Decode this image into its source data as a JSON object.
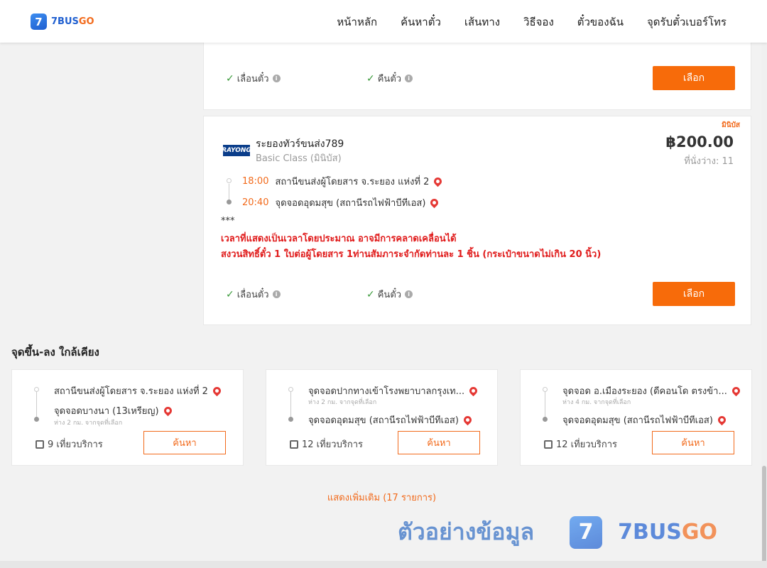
{
  "header": {
    "logo_mark": "7",
    "logo_a": "7BUS",
    "logo_b": "GO",
    "nav": [
      "หน้าหลัก",
      "ค้นหาตั๋ว",
      "เส้นทาง",
      "วิธีจอง",
      "ตั๋วของฉัน",
      "จุดรับตั๋วเบอร์โทร"
    ]
  },
  "top_card": {
    "opt1": "เลื่อนตั๋ว",
    "opt2": "คืนตั๋ว",
    "select": "เลือก"
  },
  "main_card": {
    "badge": "มินิบัส",
    "logo_text": "RAYONG",
    "operator": "ระยองทัวร์ขนส่ง789",
    "class": "Basic Class (มินิบัส)",
    "price": "฿200.00",
    "seats": "ที่นั่งว่าง: 11",
    "depart_time": "18:00",
    "depart_place": "สถานีขนส่งผู้โดยสาร จ.ระยอง แห่งที่ 2",
    "arrive_time": "20:40",
    "arrive_place": "จุดจอดอุดมสุข (สถานีรถไฟฟ้าบีทีเอส)",
    "stars": "***",
    "note1": "เวลาที่แสดงเป็นเวลาโดยประมาณ อาจมีการคลาดเคลื่อนได้",
    "note2": "สงวนสิทธิ์ตั๋ว 1 ใบต่อผู้โดยสาร 1ท่านสัมภาระจำกัดท่านละ 1 ชิ้น (กระเป๋าขนาดไม่เกิน 20 นิ้ว)",
    "opt1": "เลื่อนตั๋ว",
    "opt2": "คืนตั๋ว",
    "select": "เลือก"
  },
  "nearby": {
    "title": "จุดขึ้น-ลง ใกล้เคียง",
    "search_label": "ค้นหา",
    "cards": [
      {
        "from": "สถานีขนส่งผู้โดยสาร จ.ระยอง แห่งที่ 2",
        "from_sub": "",
        "to": "จุดจอดบางนา (13เหรียญ)",
        "to_sub": "ห่าง 2 กม. จากจุดที่เลือก",
        "trips": "9 เที่ยวบริการ"
      },
      {
        "from": "จุดจอดปากทางเข้าโรงพยาบาลกรุงเท...",
        "from_sub": "ห่าง 2 กม. จากจุดที่เลือก",
        "to": "จุดจอดอุดมสุข (สถานีรถไฟฟ้าบีทีเอส)",
        "to_sub": "",
        "trips": "12 เที่ยวบริการ"
      },
      {
        "from": "จุดจอด อ.เมืองระยอง (ดีคอนโด ตรงข้า...",
        "from_sub": "ห่าง 4 กม. จากจุดที่เลือก",
        "to": "จุดจอดอุดมสุข (สถานีรถไฟฟ้าบีทีเอส)",
        "to_sub": "",
        "trips": "12 เที่ยวบริการ"
      }
    ],
    "show_more": "แสดงเพิ่มเติม (17 รายการ)"
  },
  "watermark": {
    "text": "ตัวอย่างข้อมูล",
    "logo_mark": "7",
    "brand_a": "7BUS",
    "brand_b": "GO"
  },
  "colors": {
    "accent": "#f76b0a",
    "brand_blue": "#1f5fd0",
    "note_red": "#e01b1b",
    "check_green": "#3a9a3a"
  }
}
